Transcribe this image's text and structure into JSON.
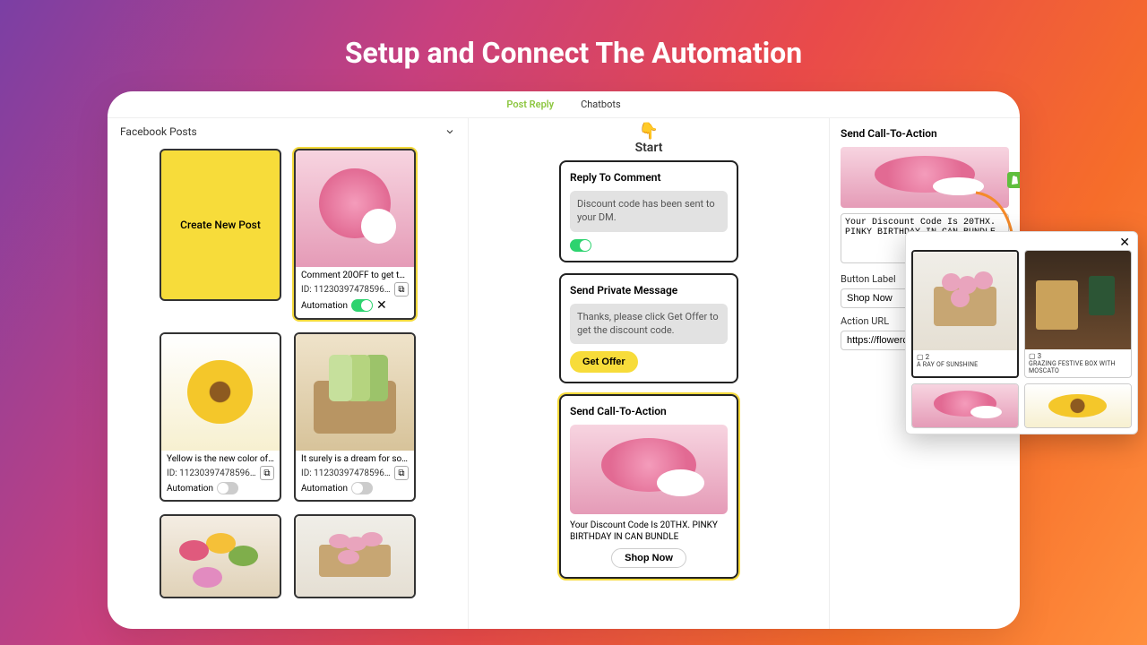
{
  "hero_title": "Setup and Connect The Automation",
  "tabs": {
    "post_reply": "Post Reply",
    "chatbots": "Chatbots"
  },
  "left": {
    "header": "Facebook Posts",
    "create_label": "Create New Post",
    "posts": [
      {
        "caption": "Comment 20OFF to get the …",
        "id": "ID: 112303974785969…",
        "automation_label": "Automation",
        "automation_on": true
      },
      {
        "caption": "Yellow is the new color of lov…",
        "id": "ID: 112303974785969…",
        "automation_label": "Automation",
        "automation_on": false
      },
      {
        "caption": "It surely is a dream for som…",
        "id": "ID: 112303974785969…",
        "automation_label": "Automation",
        "automation_on": false
      }
    ]
  },
  "mid": {
    "start_label": "Start",
    "reply": {
      "title": "Reply To Comment",
      "msg": "Discount code has been sent to your DM."
    },
    "pm": {
      "title": "Send Private Message",
      "msg": "Thanks, please click Get Offer to get the discount code.",
      "button": "Get Offer"
    },
    "cta": {
      "title": "Send Call-To-Action",
      "msg": "Your Discount Code Is 20THX. PINKY BIRTHDAY IN CAN BUNDLE",
      "button": "Shop Now"
    }
  },
  "right": {
    "title": "Send Call-To-Action",
    "textarea": "Your Discount Code Is 20THX. PINKY BIRTHDAY IN CAN BUNDLE",
    "button_label_label": "Button Label",
    "button_label_value": "Shop Now",
    "action_url_label": "Action URL",
    "action_url_value": "https://flowercool.m"
  },
  "popup": {
    "products": [
      {
        "rank": "2",
        "name": "A RAY OF SUNSHINE"
      },
      {
        "rank": "3",
        "name": "GRAZING FESTIVE BOX WITH MOSCATO"
      }
    ]
  },
  "glyphs": {
    "point_down": "👇",
    "copy": "⧉",
    "x": "✕",
    "rank": "▢"
  }
}
